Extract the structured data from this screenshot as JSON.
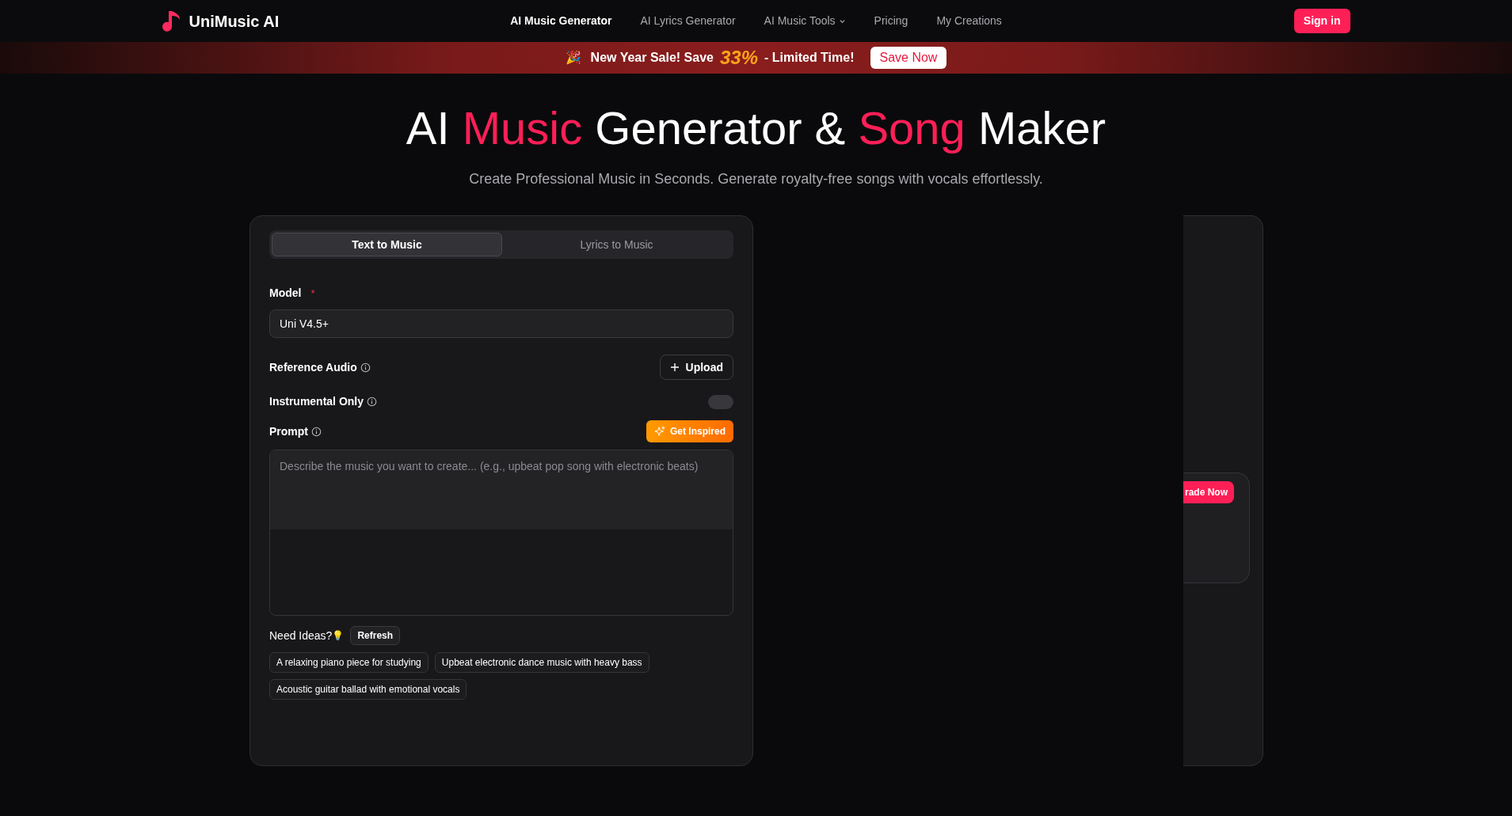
{
  "header": {
    "logo": "UniMusic AI",
    "nav": [
      {
        "label": "AI Music Generator",
        "selected": true,
        "dropdown": false
      },
      {
        "label": "AI Lyrics Generator",
        "selected": false,
        "dropdown": false
      },
      {
        "label": "AI Music Tools",
        "selected": false,
        "dropdown": true
      },
      {
        "label": "Pricing",
        "selected": false,
        "dropdown": false
      },
      {
        "label": "My Creations",
        "selected": false,
        "dropdown": false
      }
    ],
    "sign_in": "Sign in"
  },
  "banner": {
    "emoji": "🎉",
    "text_before": "New Year Sale! Save",
    "highlight": "33%",
    "text_after": "- Limited Time!",
    "button": "Save Now"
  },
  "hero": {
    "title": [
      {
        "text": "AI ",
        "accent": false
      },
      {
        "text": "Music",
        "accent": true
      },
      {
        "text": " Generator & ",
        "accent": false
      },
      {
        "text": "Song",
        "accent": true
      },
      {
        "text": " Maker",
        "accent": false
      }
    ],
    "subtitle": "Create Professional Music in Seconds. Generate royalty-free songs with vocals effortlessly."
  },
  "form": {
    "tabs": [
      {
        "label": "Text to Music",
        "selected": true
      },
      {
        "label": "Lyrics to Music",
        "selected": false
      }
    ],
    "model": {
      "label": "Model",
      "required": "*",
      "value": "Uni V4.5+"
    },
    "reference_audio": {
      "label": "Reference Audio",
      "button": "Upload"
    },
    "instrumental_only": {
      "label": "Instrumental Only",
      "on": false
    },
    "prompt": {
      "label": "Prompt",
      "button": "Get Inspired",
      "placeholder": "Describe the music you want to create... (e.g., upbeat pop song with electronic beats)"
    },
    "ideas": {
      "label": "Need Ideas?",
      "emoji": "💡",
      "refresh": "Refresh",
      "chips": [
        "A relaxing piano piece for studying",
        "Upbeat electronic dance music with heavy bass",
        "Acoustic guitar ballad with emotional vocals"
      ]
    }
  },
  "side_panel": {
    "button": "rade Now"
  }
}
